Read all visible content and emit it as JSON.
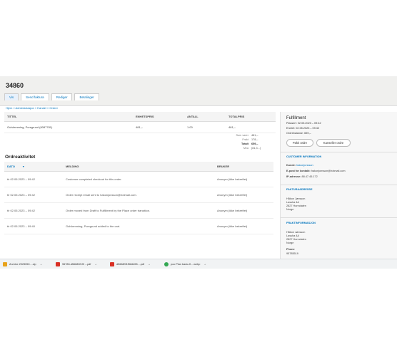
{
  "order": {
    "number": "34860"
  },
  "tabs": [
    {
      "label": "Vis"
    },
    {
      "label": "Send faktura"
    },
    {
      "label": "Rediger"
    },
    {
      "label": "Betalinger"
    }
  ],
  "breadcrumb": "Hjem » Administrasjon » Handel » Ordrer",
  "items_table": {
    "headers": [
      "TITTEL",
      "ENHETSPRIS",
      "ANTALL",
      "TOTALPRIS"
    ],
    "rows": [
      {
        "title": "Gulvlemming, Porsgrund (6087781)",
        "unit_price": "481,–",
        "qty": "1.00",
        "total": "481,–"
      }
    ]
  },
  "totals": {
    "subtotal_label": "Sum varer",
    "subtotal": "481,–",
    "shipping_label": "Frakt",
    "shipping": "178,–",
    "total_label": "Totalt",
    "total": "659,–",
    "vat_label": "Mva",
    "vat": "(81,3...)"
  },
  "activity": {
    "title": "Ordreaktivitet",
    "headers": {
      "date": "DATO",
      "message": "MELDING",
      "user": "BRUKER"
    },
    "sort_arrow": "▼",
    "rows": [
      {
        "date": "tir 02.05.2023 – 09:42",
        "message": "Customer completed checkout for this order.",
        "user": "Anonym (ikke bekreftet)"
      },
      {
        "date": "tir 02.05.2023 – 09:42",
        "message": "Order receipt email sent to hakonjonsson@hotmail.com.",
        "user": "Anonym (ikke bekreftet)"
      },
      {
        "date": "tir 02.05.2023 – 09:42",
        "message": "Order moved from Draft to Fulfillment by the Place order transition.",
        "user": "Anonym (ikke bekreftet)"
      },
      {
        "date": "tir 02.05.2023 – 09:40",
        "message": "Gulvlemming, Porsgrund added to the cart.",
        "user": "Anonym (ikke bekreftet)"
      }
    ]
  },
  "sidebar": {
    "status_title": "Fulfillment",
    "placed": "Plassert: 02.05.2023 – 09:42",
    "changed": "Endret: 02.05.2023 – 09:42",
    "balance": "Ordrebalanse: 659,–",
    "pack_button": "Pakk ordre",
    "cancel_button": "Kanseller ordre",
    "customer_title": "CUSTOMER INFORMATION",
    "customer_label": "Kunde:",
    "customer_value": "hakonjonsson",
    "email_label": "E-post for kontakt:",
    "email_value": "hakonjonsson@hotmail.com",
    "ip_label": "IP-adresse:",
    "ip_value": "88.47.45.172",
    "billing_title": "FAKTURAADRESSE",
    "billing_lines": [
      "Håkon Jønsson",
      "Lassha 4A",
      "2827 Hunndalen",
      "Norge"
    ],
    "shipping_title": "FRAKTINFORMASJON",
    "shipping_lines": [
      "Håkon Jønsson",
      "Lassha 4A",
      "2827 Hunndalen",
      "Norge"
    ],
    "phone_label": "Phone",
    "phone_value": "95785519"
  },
  "downloads": [
    {
      "name": "Archive 2023050....zip",
      "icon": "zip-icon",
      "color": "#e8a31c"
    },
    {
      "name": "96780-d56680f1f3 ...pdf",
      "icon": "pdf-icon",
      "color": "#d93025"
    },
    {
      "name": "d56680f1f5b6b55....pdf",
      "icon": "pdf-icon",
      "color": "#d93025"
    },
    {
      "name": "poo Plan basic-fl....webp",
      "icon": "chrome-icon",
      "color": "#34a853"
    }
  ]
}
